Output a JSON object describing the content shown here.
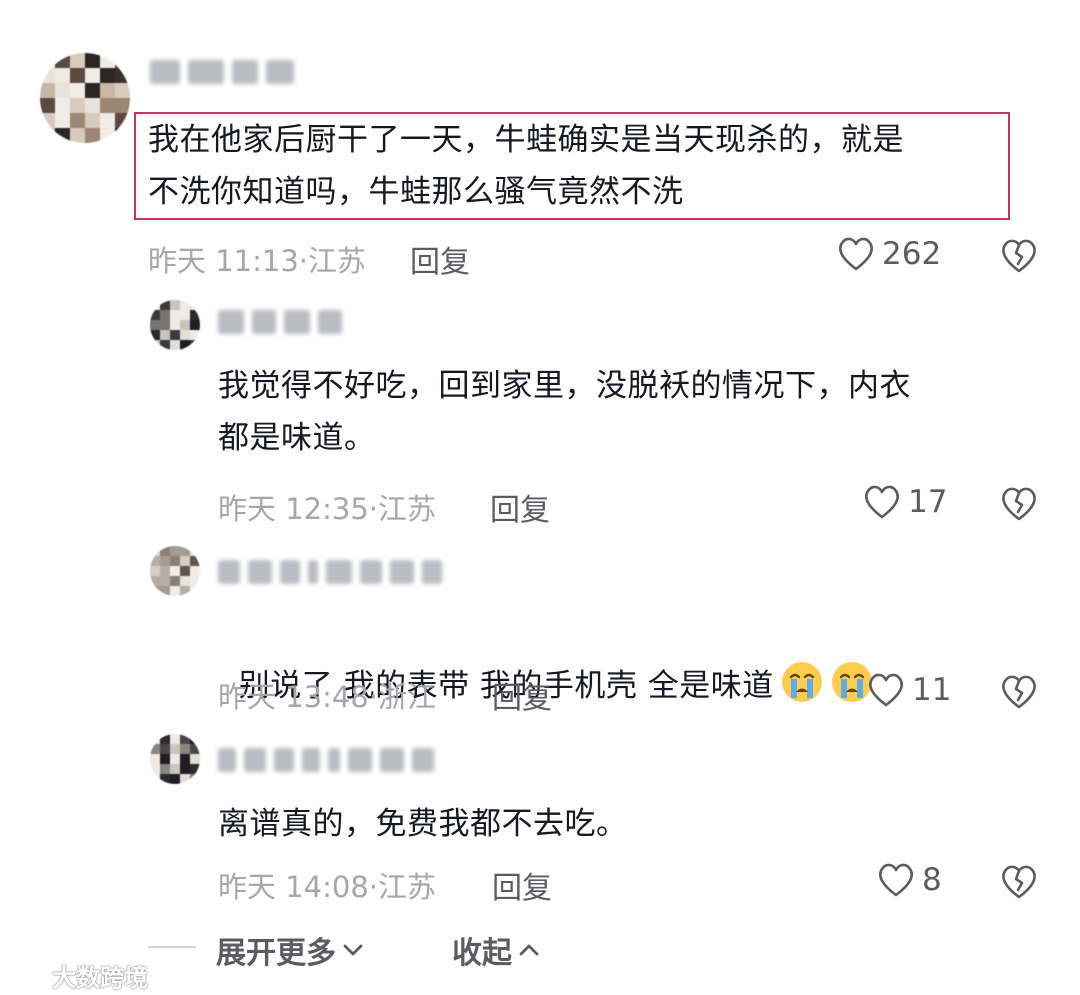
{
  "comments": [
    {
      "text": "我在他家后厨干了一天，牛蛙确实是当天现杀的，就是\n不洗你知道吗，牛蛙那么骚气竟然不洗",
      "time_location": "昨天 11:13·江苏",
      "reply_label": "回复",
      "likes": "262"
    },
    {
      "text": "我觉得不好吃，回到家里，没脱袄的情况下，内衣\n都是味道。",
      "time_location": "昨天 12:35·江苏",
      "reply_label": "回复",
      "likes": "17"
    },
    {
      "text": "别说了 我的表带 我的手机壳 全是味道",
      "time_location": "昨天 13:48·浙江",
      "reply_label": "回复",
      "likes": "11",
      "emoji": [
        "crying-face",
        "crying-face"
      ]
    },
    {
      "text": "离谱真的，免费我都不去吃。",
      "time_location": "昨天 14:08·江苏",
      "reply_label": "回复",
      "likes": "8"
    }
  ],
  "footer": {
    "expand_label": "展开更多",
    "collapse_label": "收起"
  },
  "watermark": {
    "text": "大数跨境"
  },
  "icons": {
    "like": "heart-outline-icon",
    "dislike": "broken-heart-icon",
    "expand": "chevron-down-icon",
    "collapse": "chevron-up-icon"
  },
  "colors": {
    "highlight_border": "#c8355a",
    "text": "#161823",
    "meta": "#a6a7ab"
  }
}
